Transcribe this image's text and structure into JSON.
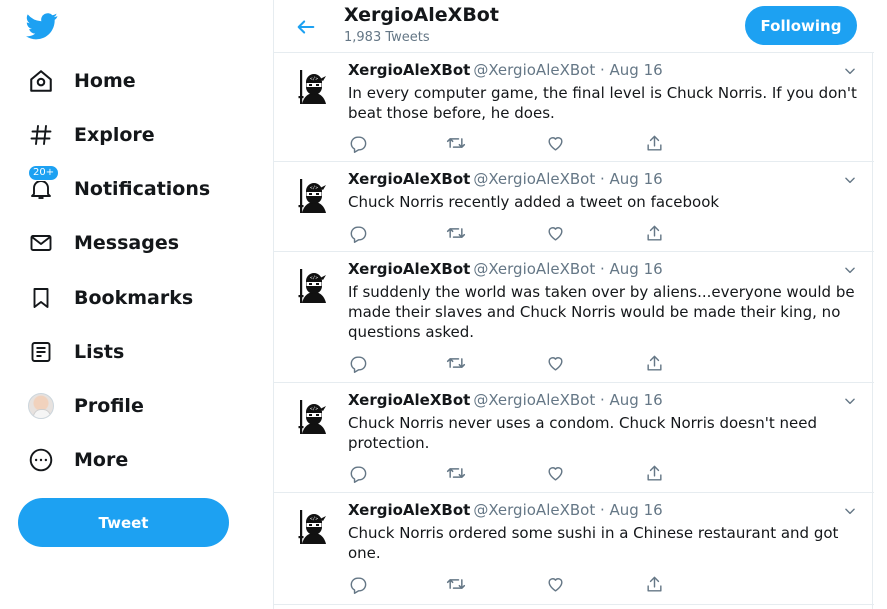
{
  "sidebar": {
    "logo": "twitter-bird-icon",
    "items": [
      {
        "label": "Home",
        "icon": "home-icon"
      },
      {
        "label": "Explore",
        "icon": "hashtag-icon"
      },
      {
        "label": "Notifications",
        "icon": "bell-icon",
        "badge": "20+"
      },
      {
        "label": "Messages",
        "icon": "envelope-icon"
      },
      {
        "label": "Bookmarks",
        "icon": "bookmark-icon"
      },
      {
        "label": "Lists",
        "icon": "list-icon"
      },
      {
        "label": "Profile",
        "icon": "avatar"
      },
      {
        "label": "More",
        "icon": "more-circle-icon"
      }
    ],
    "tweet_button": "Tweet"
  },
  "header": {
    "title": "XergioAleXBot",
    "subtitle": "1,983 Tweets",
    "follow_button": "Following"
  },
  "colors": {
    "accent": "#1da1f2",
    "text": "#14171a",
    "muted": "#657786",
    "border": "#e6ecf0"
  },
  "tweets": [
    {
      "name": "XergioAleXBot",
      "meta": "@XergioAleXBot · Aug 16",
      "text": "In every computer game, the final level is Chuck Norris. If you don't beat those before, he does."
    },
    {
      "name": "XergioAleXBot",
      "meta": "@XergioAleXBot · Aug 16",
      "text": "Chuck Norris recently added a tweet on facebook"
    },
    {
      "name": "XergioAleXBot",
      "meta": "@XergioAleXBot · Aug 16",
      "text": "If suddenly the world was taken over by aliens...everyone would be made their slaves and Chuck Norris would be made their king, no questions asked."
    },
    {
      "name": "XergioAleXBot",
      "meta": "@XergioAleXBot · Aug 16",
      "text": "Chuck Norris never uses a condom. Chuck Norris doesn't need protection."
    },
    {
      "name": "XergioAleXBot",
      "meta": "@XergioAleXBot · Aug 16",
      "text": "Chuck Norris ordered some sushi in a Chinese restaurant and got one."
    }
  ]
}
